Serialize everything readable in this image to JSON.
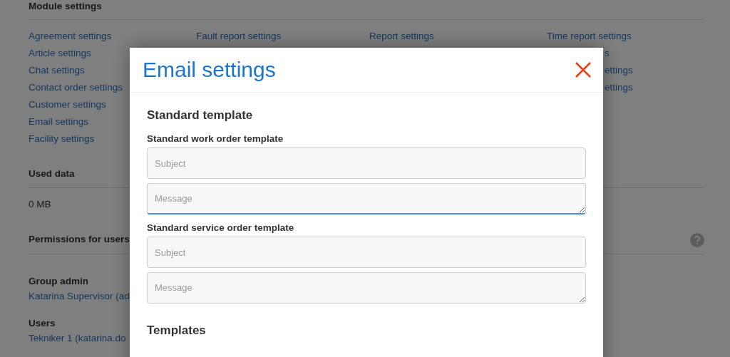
{
  "page": {
    "module_settings": {
      "title": "Module settings",
      "columns": [
        [
          {
            "label": "Agreement settings"
          },
          {
            "label": "Article settings"
          },
          {
            "label": "Chat settings"
          },
          {
            "label": "Contact order settings"
          },
          {
            "label": "Customer settings"
          },
          {
            "label": "Email settings"
          },
          {
            "label": "Facility settings"
          }
        ],
        [
          {
            "label": "Fault report settings"
          }
        ],
        [
          {
            "label": "Report settings"
          }
        ],
        [
          {
            "label": "Time report settings",
            "cut": false
          },
          {
            "label": "s",
            "cut": true
          },
          {
            "label": "ettings",
            "cut": true
          },
          {
            "label": "ettings",
            "cut": true
          }
        ]
      ]
    },
    "used_data": {
      "title": "Used data",
      "value": "0 MB"
    },
    "permissions": {
      "title": "Permissions for users"
    },
    "group_admin": {
      "title": "Group admin",
      "members": [
        "Katarina Supervisor (ad"
      ]
    },
    "users": {
      "title": "Users",
      "members": [
        "Tekniker 1 (katarina.do"
      ]
    }
  },
  "modal": {
    "title": "Email settings",
    "sections": [
      {
        "title": "Standard template",
        "templates": [
          {
            "label": "Standard work order template",
            "fields": [
              {
                "kind": "input",
                "placeholder": "Subject",
                "focused": false
              },
              {
                "kind": "textarea",
                "placeholder": "Message",
                "focused": true
              }
            ]
          },
          {
            "label": "Standard service order template",
            "fields": [
              {
                "kind": "input",
                "placeholder": "Subject",
                "focused": false
              },
              {
                "kind": "textarea",
                "placeholder": "Message",
                "focused": false
              }
            ]
          }
        ]
      },
      {
        "title": "Templates"
      }
    ]
  }
}
